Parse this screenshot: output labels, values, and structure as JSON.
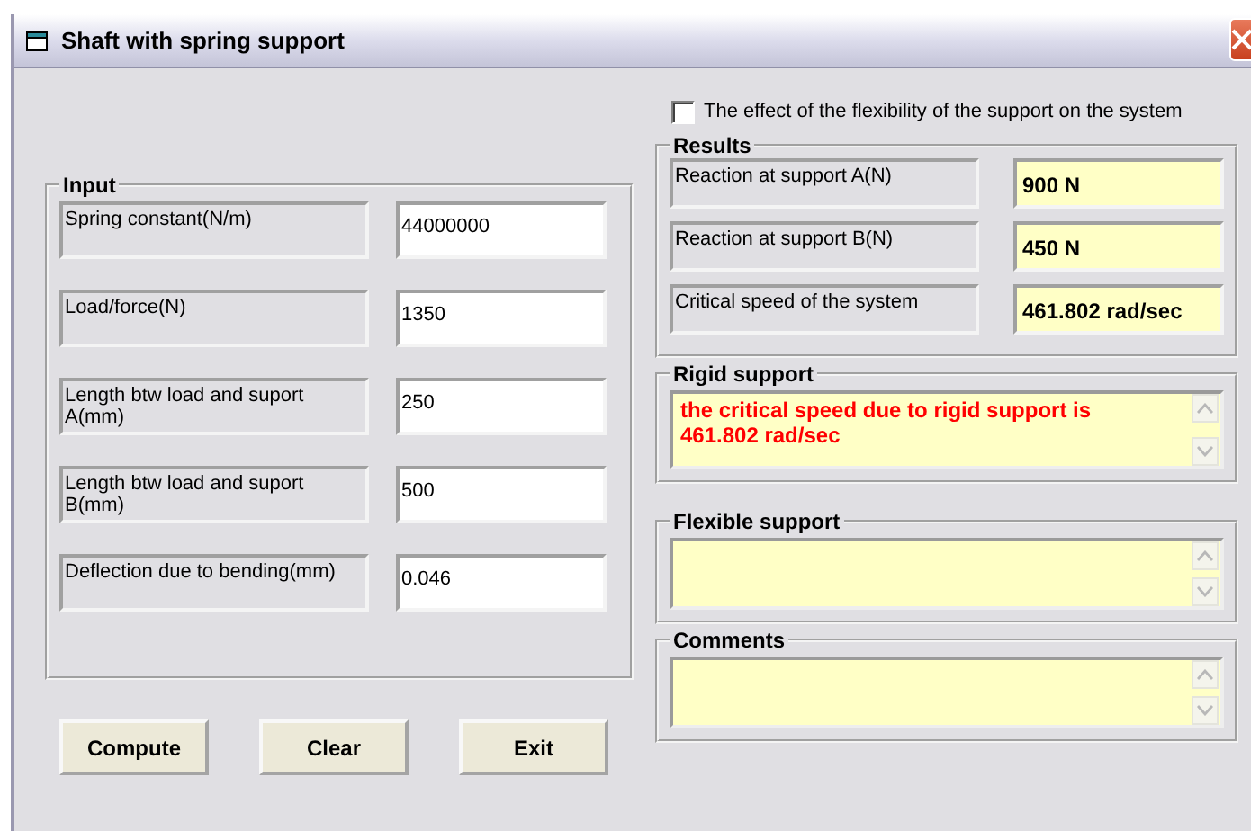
{
  "window": {
    "title": "Shaft with spring support"
  },
  "flexibility_option": {
    "label": "The effect of the flexibility of the support on the system",
    "checked": false
  },
  "input": {
    "title": "Input",
    "rows": [
      {
        "label": "Spring constant(N/m)",
        "value": "44000000"
      },
      {
        "label": "Load/force(N)",
        "value": "1350"
      },
      {
        "label": "Length btw load and suport A(mm)",
        "value": "250"
      },
      {
        "label": "Length btw load and suport B(mm)",
        "value": "500"
      },
      {
        "label": "Deflection due to bending(mm)",
        "value": "0.046"
      }
    ]
  },
  "buttons": [
    "Compute",
    "Clear",
    "Exit"
  ],
  "results": {
    "title": "Results",
    "rows": [
      {
        "label": "Reaction at support A(N)",
        "value": "900 N"
      },
      {
        "label": "Reaction at support B(N)",
        "value": "450 N"
      },
      {
        "label": "Critical speed  of the system",
        "value": "461.802 rad/sec"
      }
    ]
  },
  "rigid_support": {
    "title": "Rigid support",
    "text": "the critical speed due to rigid support is 461.802 rad/sec"
  },
  "flexible_support": {
    "title": "Flexible support"
  },
  "comments": {
    "title": "Comments"
  }
}
